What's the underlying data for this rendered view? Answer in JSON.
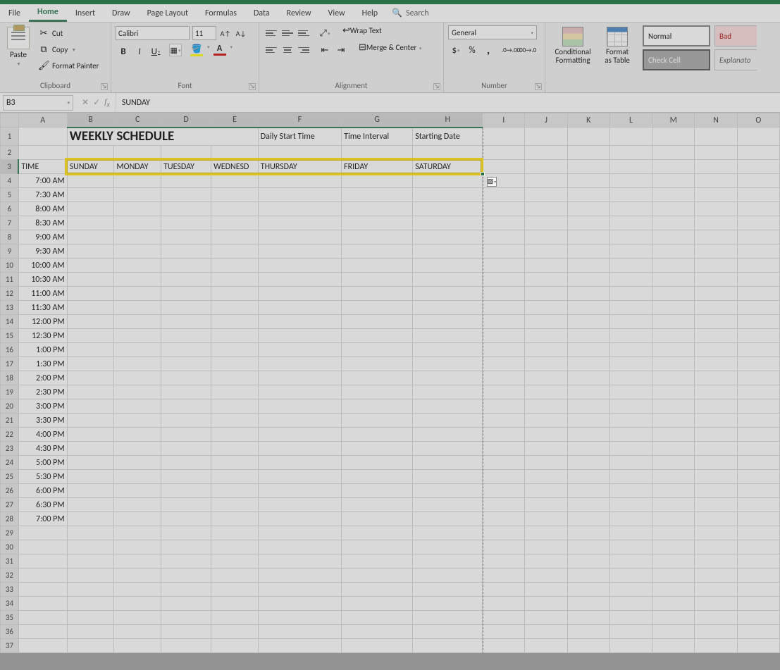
{
  "tabs": [
    "File",
    "Home",
    "Insert",
    "Draw",
    "Page Layout",
    "Formulas",
    "Data",
    "Review",
    "View",
    "Help"
  ],
  "active_tab": "Home",
  "search_label": "Search",
  "ribbon": {
    "clipboard": {
      "paste": "Paste",
      "cut": "Cut",
      "copy": "Copy",
      "painter": "Format Painter",
      "label": "Clipboard"
    },
    "font": {
      "name": "Calibri",
      "size": "11",
      "label": "Font"
    },
    "alignment": {
      "wrap": "Wrap Text",
      "merge": "Merge & Center",
      "label": "Alignment"
    },
    "number": {
      "format": "General",
      "label": "Number"
    },
    "cond": "Conditional\nFormatting",
    "table": "Format as\nTable",
    "styles": {
      "normal": "Normal",
      "bad": "Bad",
      "check": "Check Cell",
      "explan": "Explanato"
    }
  },
  "namebox": "B3",
  "formula": "SUNDAY",
  "columns": [
    "A",
    "B",
    "C",
    "D",
    "E",
    "F",
    "G",
    "H",
    "I",
    "J",
    "K",
    "L",
    "M",
    "N",
    "O"
  ],
  "row1": {
    "a": "",
    "b_title": "WEEKLY SCHEDULE",
    "f": "Daily Start Time",
    "g": "Time Interval",
    "h": "Starting Date"
  },
  "row3": {
    "a": "TIME",
    "days": [
      "SUNDAY",
      "MONDAY",
      "TUESDAY",
      "WEDNESD",
      "THURSDAY",
      "FRIDAY",
      "SATURDAY"
    ]
  },
  "times": [
    "7:00 AM",
    "7:30 AM",
    "8:00 AM",
    "8:30 AM",
    "9:00 AM",
    "9:30 AM",
    "10:00 AM",
    "10:30 AM",
    "11:00 AM",
    "11:30 AM",
    "12:00 PM",
    "12:30 PM",
    "1:00 PM",
    "1:30 PM",
    "2:00 PM",
    "2:30 PM",
    "3:00 PM",
    "3:30 PM",
    "4:00 PM",
    "4:30 PM",
    "5:00 PM",
    "5:30 PM",
    "6:00 PM",
    "6:30 PM",
    "7:00 PM"
  ],
  "empty_rows_after": 9
}
